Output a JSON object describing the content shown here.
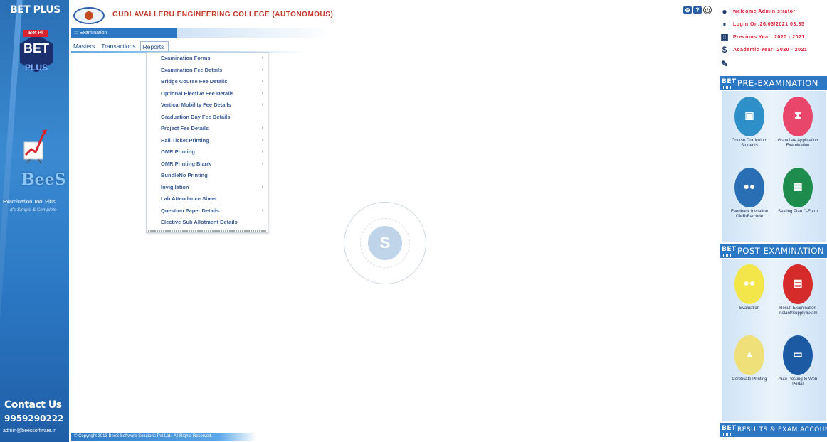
{
  "sidebar": {
    "title": "BET PLUS",
    "logo_tag": "Bet Pl",
    "logo_main": "BET",
    "logo_sub": "PLUS",
    "brand": "BeeS",
    "tool_name": "Examination Tool Plus",
    "tagline": "It's Simple & Complete",
    "contact_label": "Contact Us",
    "phone": "9959290222",
    "email": "admin@beessoftware.in"
  },
  "header": {
    "college_name": "GUDLAVALLERU ENGINEERING COLLEGE (AUTONOMOUS)",
    "breadcrumb": "::: Examination"
  },
  "menu": {
    "items": [
      "Masters",
      "Transactions",
      "Reports"
    ],
    "active": "Reports"
  },
  "reports_menu": [
    {
      "label": "Examination Forms",
      "submenu": true
    },
    {
      "label": "Examination Fee Details",
      "submenu": true
    },
    {
      "label": "Bridge Course Fee Details",
      "submenu": true
    },
    {
      "label": "Optional Elective Fee Details",
      "submenu": true
    },
    {
      "label": "Vertical Mobility Fee Details",
      "submenu": true
    },
    {
      "label": "Graduation Day Fee Details",
      "submenu": false
    },
    {
      "label": "Project Fee Details",
      "submenu": true
    },
    {
      "label": "Hall Ticket Printing",
      "submenu": true
    },
    {
      "label": "OMR Printing",
      "submenu": true
    },
    {
      "label": "OMR Printing Blank",
      "submenu": true
    },
    {
      "label": "BundleNo Printing",
      "submenu": false
    },
    {
      "label": "Invigilation",
      "submenu": true
    },
    {
      "label": "Lab Attendance Sheet",
      "submenu": false
    },
    {
      "label": "Question Paper Details",
      "submenu": true
    },
    {
      "label": "Elective Sub Allotment Details",
      "submenu": false
    }
  ],
  "arrow_glyph": "›",
  "footer": "© Copyright 2013 BeeS Software Solutions Pvt Ltd., All Rights Reserved.",
  "tools": [
    "⊖",
    "?",
    "⏻"
  ],
  "right_panel": {
    "welcome": "welcome Administrator",
    "login": "Login On:26/03/2021 03:35",
    "previous_year": "Previous Year: 2020 - 2021",
    "academic_year": "Academic Year: 2020 - 2021",
    "pre_exam_title": "PRE-EXAMINATION",
    "post_exam_title": "POST EXAMINATION",
    "results_title": "RESULTS & EXAM ACCOUNT",
    "bt_label": "BET",
    "pre_tiles": [
      {
        "caption": "Course Curriculum Students",
        "color": "#2f8fc9",
        "glyph": "▣"
      },
      {
        "caption": "Granulate Application Examination",
        "color": "#e8466b",
        "glyph": "⧗"
      },
      {
        "caption": "Feedback Invitation OMR/Barcode",
        "color": "#2a6fb5",
        "glyph": "●●"
      },
      {
        "caption": "Seating Plan D-Form",
        "color": "#1e8c4c",
        "glyph": "▦"
      }
    ],
    "post_tiles": [
      {
        "caption": "Evaluation",
        "color": "#f2e64a",
        "glyph": "●●"
      },
      {
        "caption": "Result Examination Instant/Supply Exam",
        "color": "#d62b2b",
        "glyph": "▤"
      },
      {
        "caption": "Certificate Printing",
        "color": "#efe07a",
        "glyph": "▲"
      },
      {
        "caption": "Auto Posting to Web Portal",
        "color": "#1d5aa4",
        "glyph": "▭"
      }
    ]
  }
}
